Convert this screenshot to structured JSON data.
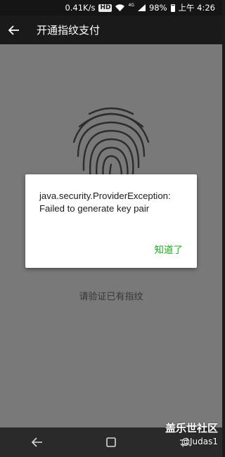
{
  "status_bar": {
    "speed": "0.41K/s",
    "hd": "HD",
    "network": "4G",
    "battery": "98%",
    "time": "上午 4:26"
  },
  "app_bar": {
    "title": "开通指纹支付",
    "back_icon": "arrow-left-icon"
  },
  "content": {
    "fingerprint_icon": "fingerprint-icon",
    "hint": "请验证已有指纹"
  },
  "dialog": {
    "message_line1": "java.security.ProviderException:",
    "message_line2": "Failed to generate key pair",
    "confirm_label": "知道了"
  },
  "nav_bar": {
    "back_icon": "nav-back-icon",
    "home_icon": "square-home-icon",
    "recents_icon": "recents-icon"
  },
  "watermark": {
    "title": "盖乐世社区",
    "user": "@Judas1"
  },
  "colors": {
    "accent_green": "#1aad19",
    "app_bar": "#1a1a1a"
  }
}
